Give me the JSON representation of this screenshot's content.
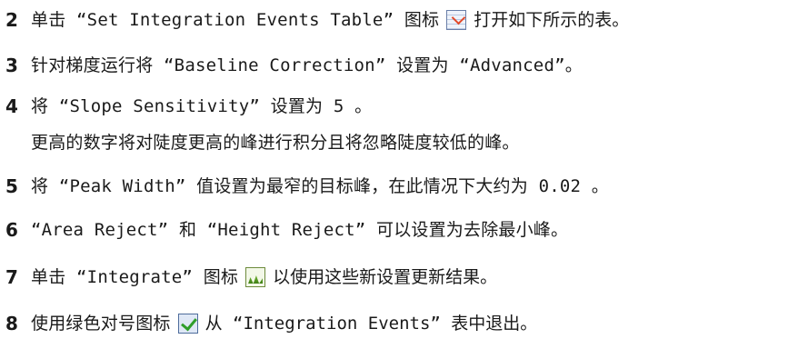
{
  "steps": [
    {
      "num": "2",
      "pre": "单击 “Set Integration Events Table” 图标",
      "icon": "table-icon",
      "post": "打开如下所示的表。"
    },
    {
      "num": "3",
      "text": "针对梯度运行将 “Baseline Correction” 设置为 “Advanced”。"
    },
    {
      "num": "4",
      "text": "将 “Slope Sensitivity” 设置为 5 。",
      "note": "更高的数字将对陡度更高的峰进行积分且将忽略陡度较低的峰。"
    },
    {
      "num": "5",
      "text": "将 “Peak Width” 值设置为最窄的目标峰，在此情况下大约为 0.02 。"
    },
    {
      "num": "6",
      "text": "“Area Reject” 和 “Height Reject” 可以设置为去除最小峰。"
    },
    {
      "num": "7",
      "pre": "单击 “Integrate” 图标",
      "icon": "integrate-icon",
      "post": "以使用这些新设置更新结果。"
    },
    {
      "num": "8",
      "pre": "使用绿色对号图标",
      "icon": "checkmark-icon",
      "post": "从 “Integration Events” 表中退出。"
    }
  ]
}
